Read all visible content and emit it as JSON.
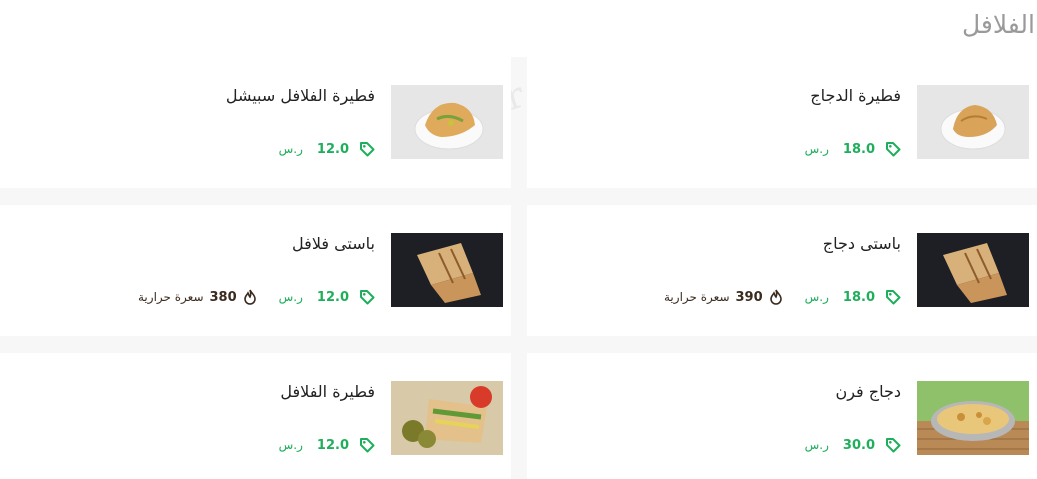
{
  "section": {
    "title": "الفلافل"
  },
  "watermark": "cafe-r",
  "cards": [
    {
      "name": "فطيرة الدجاج",
      "price": "18.0",
      "currency": "ر.س",
      "image": "chicken-pie",
      "calories": null,
      "calories_unit": null
    },
    {
      "name": "فطيرة الفلافل سبيشل",
      "price": "12.0",
      "currency": "ر.س",
      "image": "falafel-pie-special",
      "calories": null,
      "calories_unit": null
    },
    {
      "name": "باستى دجاج",
      "price": "18.0",
      "currency": "ر.س",
      "image": "chicken-pasty",
      "calories": "390",
      "calories_unit": "سعرة حرارية"
    },
    {
      "name": "باستى فلافل",
      "price": "12.0",
      "currency": "ر.س",
      "image": "falafel-pasty",
      "calories": "380",
      "calories_unit": "سعرة حرارية"
    },
    {
      "name": "دجاج فرن",
      "price": "30.0",
      "currency": "ر.س",
      "image": "oven-chicken",
      "calories": null,
      "calories_unit": null
    },
    {
      "name": "فطيرة الفلافل",
      "price": "12.0",
      "currency": "ر.س",
      "image": "falafel-pie",
      "calories": null,
      "calories_unit": null
    }
  ],
  "colors": {
    "price": "#1fae5b",
    "calories": "#3a2b1f",
    "title": "#9a9a9a"
  }
}
